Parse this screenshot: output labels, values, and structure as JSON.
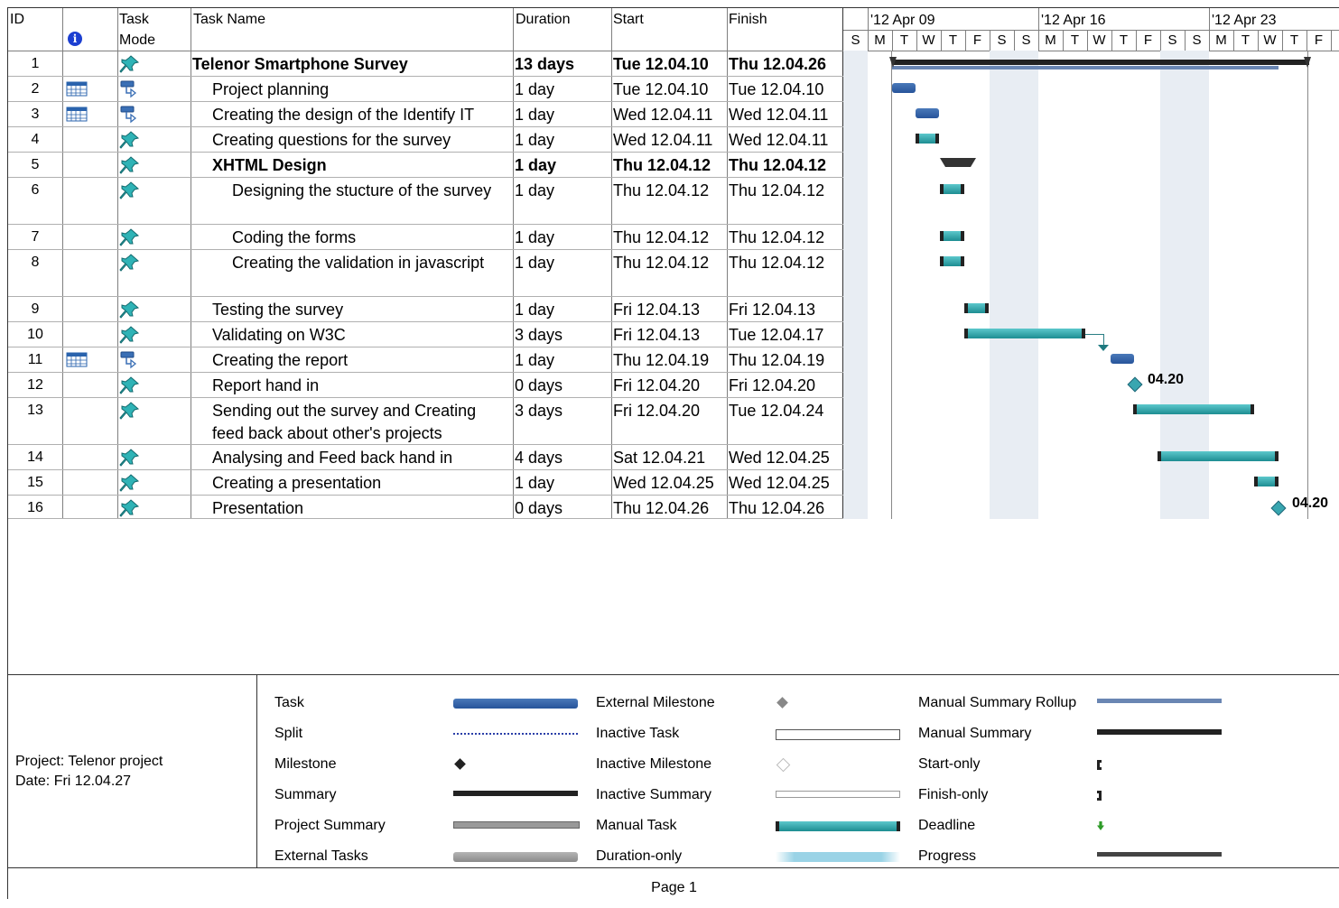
{
  "headers": {
    "id": "ID",
    "mode": "Task Mode",
    "mode1": "Task",
    "mode2": "Mode",
    "name": "Task Name",
    "duration": "Duration",
    "start": "Start",
    "finish": "Finish"
  },
  "timeline": {
    "weeks": [
      "'12 Apr 09",
      "'12 Apr 16",
      "'12 Apr 23"
    ],
    "days": [
      "S",
      "M",
      "T",
      "W",
      "T",
      "F",
      "S",
      "S",
      "M",
      "T",
      "W",
      "T",
      "F",
      "S",
      "S",
      "M",
      "T",
      "W",
      "T",
      "F"
    ]
  },
  "tasks": [
    {
      "id": "1",
      "name": "Telenor Smartphone Survey",
      "duration": "13 days",
      "start": "Tue 12.04.10",
      "finish": "Thu 12.04.26",
      "bold": true,
      "indent": 0,
      "mode": "manual"
    },
    {
      "id": "2",
      "name": "Project planning",
      "duration": "1 day",
      "start": "Tue 12.04.10",
      "finish": "Tue 12.04.10",
      "indent": 1,
      "mode": "auto",
      "cal": true
    },
    {
      "id": "3",
      "name": "Creating the design of the Identify IT",
      "duration": "1 day",
      "start": "Wed 12.04.11",
      "finish": "Wed 12.04.11",
      "indent": 1,
      "mode": "auto",
      "cal": true
    },
    {
      "id": "4",
      "name": "Creating questions for the survey",
      "duration": "1 day",
      "start": "Wed 12.04.11",
      "finish": "Wed 12.04.11",
      "indent": 1,
      "mode": "manual"
    },
    {
      "id": "5",
      "name": "XHTML Design",
      "duration": "1 day",
      "start": "Thu 12.04.12",
      "finish": "Thu 12.04.12",
      "bold": true,
      "indent": 1,
      "mode": "manual"
    },
    {
      "id": "6",
      "name": "Designing the stucture of the survey",
      "duration": "1 day",
      "start": "Thu 12.04.12",
      "finish": "Thu 12.04.12",
      "indent": 2,
      "mode": "manual"
    },
    {
      "id": "7",
      "name": "Coding the forms",
      "duration": "1 day",
      "start": "Thu 12.04.12",
      "finish": "Thu 12.04.12",
      "indent": 2,
      "mode": "manual"
    },
    {
      "id": "8",
      "name": "Creating the validation in javascript",
      "duration": "1 day",
      "start": "Thu 12.04.12",
      "finish": "Thu 12.04.12",
      "indent": 2,
      "mode": "manual"
    },
    {
      "id": "9",
      "name": "Testing the survey",
      "duration": "1 day",
      "start": "Fri 12.04.13",
      "finish": "Fri 12.04.13",
      "indent": 1,
      "mode": "manual"
    },
    {
      "id": "10",
      "name": "Validating on W3C",
      "duration": "3 days",
      "start": "Fri 12.04.13",
      "finish": "Tue 12.04.17",
      "indent": 1,
      "mode": "manual"
    },
    {
      "id": "11",
      "name": "Creating the report",
      "duration": "1 day",
      "start": "Thu 12.04.19",
      "finish": "Thu 12.04.19",
      "indent": 1,
      "mode": "auto",
      "cal": true
    },
    {
      "id": "12",
      "name": "Report hand in",
      "duration": "0 days",
      "start": "Fri 12.04.20",
      "finish": "Fri 12.04.20",
      "indent": 1,
      "mode": "manual"
    },
    {
      "id": "13",
      "name": "Sending out the survey and Creating",
      "name2": "feed back about other's projects",
      "duration": "3 days",
      "start": "Fri 12.04.20",
      "finish": "Tue 12.04.24",
      "indent": 1,
      "mode": "manual"
    },
    {
      "id": "14",
      "name": "Analysing and Feed back hand in",
      "duration": "4 days",
      "start": "Sat 12.04.21",
      "finish": "Wed 12.04.25",
      "indent": 1,
      "mode": "manual"
    },
    {
      "id": "15",
      "name": "Creating a presentation",
      "duration": "1 day",
      "start": "Wed 12.04.25",
      "finish": "Wed 12.04.25",
      "indent": 1,
      "mode": "manual"
    },
    {
      "id": "16",
      "name": "Presentation",
      "duration": "0 days",
      "start": "Thu 12.04.26",
      "finish": "Thu 12.04.26",
      "indent": 1,
      "mode": "manual"
    }
  ],
  "milestone_labels": {
    "m12": "04.20",
    "m16": "04.20"
  },
  "legend": {
    "project": "Project: Telenor project",
    "date": "Date: Fri 12.04.27",
    "col1": [
      "Task",
      "Split",
      "Milestone",
      "Summary",
      "Project Summary",
      "External Tasks"
    ],
    "col2": [
      "External Milestone",
      "Inactive Task",
      "Inactive Milestone",
      "Inactive Summary",
      "Manual Task",
      "Duration-only"
    ],
    "col3": [
      "Manual Summary Rollup",
      "Manual Summary",
      "Start-only",
      "Finish-only",
      "Deadline",
      "Progress"
    ]
  },
  "footer": "Page 1",
  "colors": {
    "task": "#2f5f9e",
    "manual": "#30a8ad",
    "weekend": "#e8edf3"
  }
}
